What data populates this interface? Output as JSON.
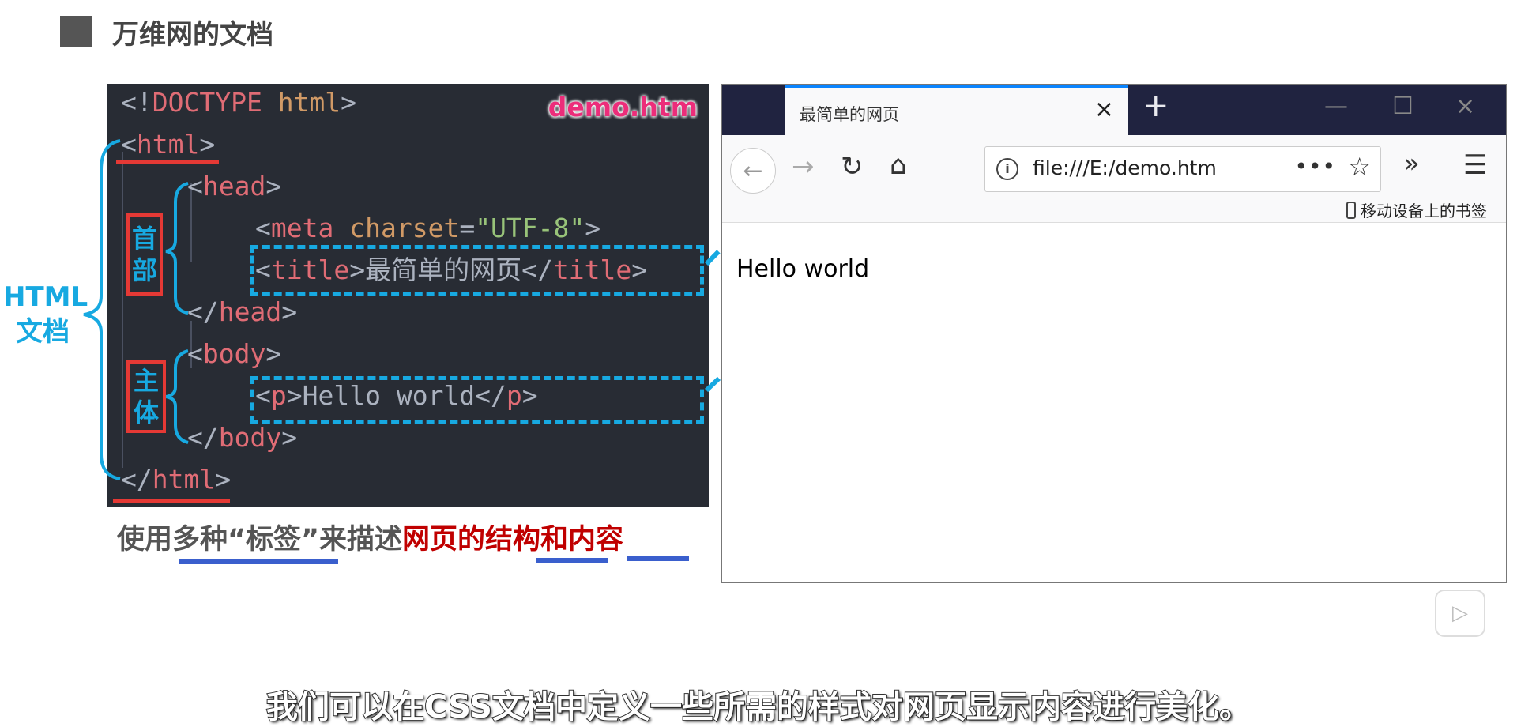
{
  "header": {
    "title": "万维网的文档"
  },
  "code": {
    "file_label": "demo.htm",
    "doctype_open": "<!",
    "doctype_kw": "DOCTYPE",
    "doctype_name": " html",
    "doctype_close": ">",
    "lines": [
      {
        "lt": "<",
        "tag": "html",
        "gt": ">"
      },
      {
        "lt": "<",
        "tag": "head",
        "gt": ">"
      },
      {
        "lt": "<",
        "tag": "meta",
        "attr": " charset",
        "eq": "=",
        "str": "\"UTF-8\"",
        "gt": ">"
      },
      {
        "lt": "<",
        "tag": "title",
        "gt": ">",
        "text": "最简单的网页",
        "close_lt": "</",
        "close_tag": "title",
        "close_gt": ">"
      },
      {
        "lt": "</",
        "tag": "head",
        "gt": ">"
      },
      {
        "lt": "<",
        "tag": "body",
        "gt": ">"
      },
      {
        "lt": "<",
        "tag": "p",
        "gt": ">",
        "text": "Hello world",
        "close_lt": "</",
        "close_tag": "p",
        "close_gt": ">"
      },
      {
        "lt": "</",
        "tag": "body",
        "gt": ">"
      },
      {
        "lt": "</",
        "tag": "html",
        "gt": ">"
      }
    ]
  },
  "annotations": {
    "html_doc_line1": "HTML",
    "html_doc_line2": "文档",
    "head_line1": "首",
    "head_line2": "部",
    "body_line1": "主",
    "body_line2": "体",
    "accent_color": "#17a9e1",
    "highlight_color": "#e53935"
  },
  "caption": {
    "part1": "使用多种“标签”来描述",
    "part2": "网页的结构和内容"
  },
  "browser": {
    "tab_title": "最简单的网页",
    "tab_close": "×",
    "new_tab": "+",
    "win_minimize": "—",
    "win_maximize": "☐",
    "win_close": "×",
    "url_info": "i",
    "url": "file:///E:/demo.htm",
    "url_more": "•••",
    "url_star": "☆",
    "overflow": "»",
    "menu": "☰",
    "back": "←",
    "forward": "→",
    "reload": "↻",
    "home": "⌂",
    "bookmark": "移动设备上的书签",
    "page_text": "Hello world"
  },
  "video": {
    "play": "▷"
  },
  "subtitle": "我们可以在CSS文档中定义一些所需的样式对网页显示内容进行美化。"
}
